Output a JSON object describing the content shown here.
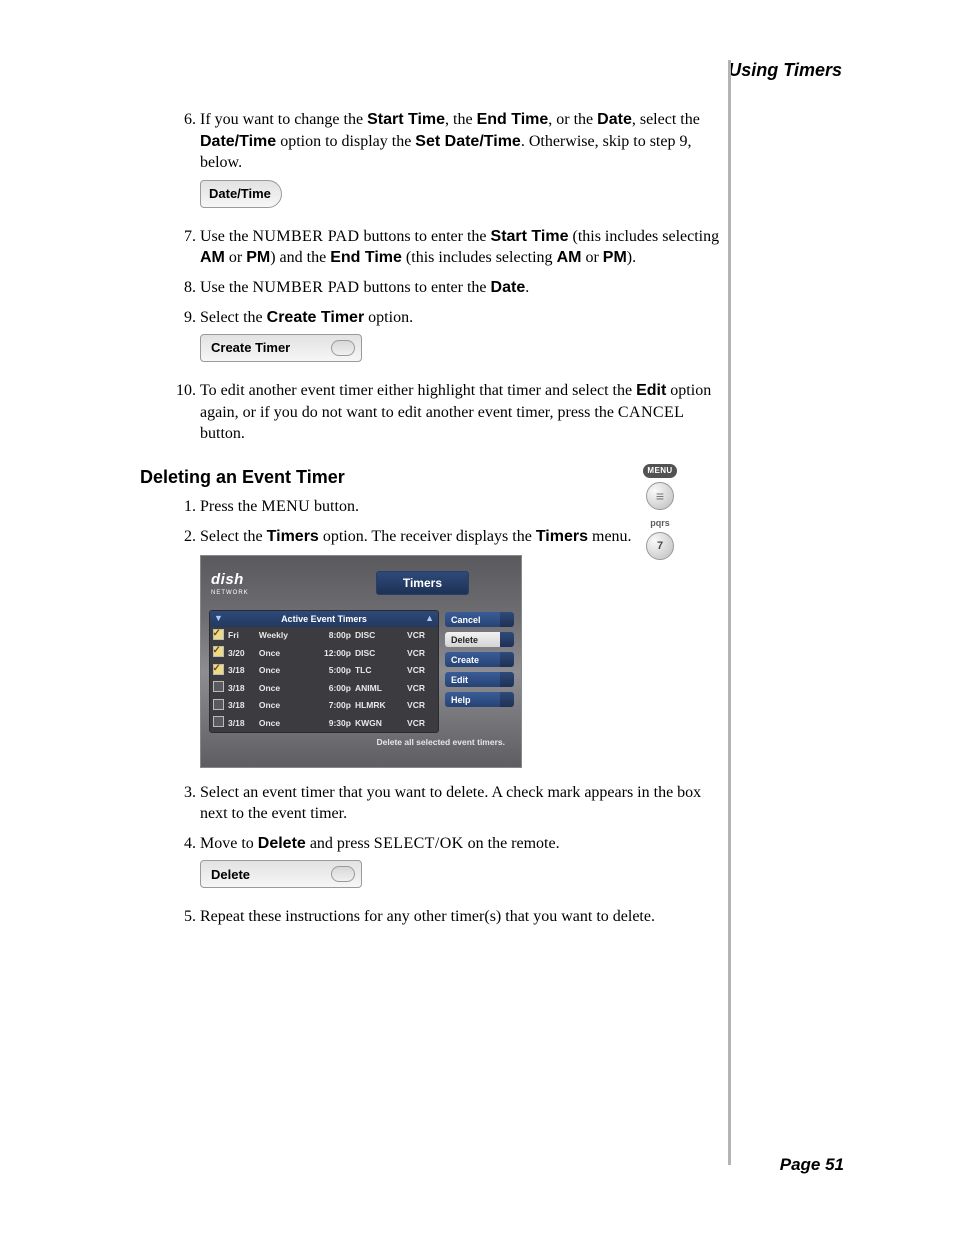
{
  "header": {
    "title": "Using Timers"
  },
  "footer": {
    "page_label": "Page 51"
  },
  "steps_a_start": 6,
  "steps_a": [
    {
      "pre": "If you want to change the ",
      "b1": "Start Time",
      "mid1": ", the ",
      "b2": "End Time",
      "mid2": ", or the ",
      "b3": "Date",
      "mid3": ", select the ",
      "b4": "Date/Time",
      "mid4": " option to display the ",
      "b5": "Set Date/Time",
      "post": ". Otherwise, skip to step 9, below."
    },
    {
      "pre": "Use the ",
      "sc1": "NUMBER PAD",
      "mid1": " buttons to enter the ",
      "b1": "Start Time",
      "mid2": " (this includes selecting ",
      "b2": "AM",
      "mid3": " or ",
      "b3": "PM",
      "mid4": ") and the ",
      "b4": "End Time",
      "mid5": " (this includes selecting ",
      "b5": "AM",
      "mid6": " or ",
      "b6": "PM",
      "post": ")."
    },
    {
      "pre": "Use the ",
      "sc1": "NUMBER PAD",
      "mid1": " buttons to enter the ",
      "b1": "Date",
      "post": "."
    },
    {
      "pre": "Select the ",
      "b1": "Create Timer",
      "post": " option."
    },
    {
      "pre": "To edit another event timer either highlight that timer and select the ",
      "b1": "Edit",
      "mid1": " option again, or if you do not want to edit another event timer, press the ",
      "sc1": "CANCEL",
      "post": " button."
    }
  ],
  "chips": {
    "datetime": "Date/Time",
    "create_timer": "Create Timer",
    "delete": "Delete"
  },
  "section_b_title": "Deleting an Event Timer",
  "steps_b": [
    {
      "pre": "Press the ",
      "sc1": "MENU",
      "post": " button."
    },
    {
      "pre": "Select the ",
      "b1": "Timers",
      "mid1": " option. The receiver displays the ",
      "b2": "Timers",
      "post": " menu."
    },
    {
      "pre": "Select an event timer that you want to delete. A check mark appears in the box next to the event timer.",
      "b1": "",
      "post": ""
    },
    {
      "pre": "Move to ",
      "b1": "Delete",
      "mid1": " and press ",
      "sc1": "SELECT/OK",
      "post": " on the remote."
    },
    {
      "pre": "Repeat these instructions for any other timer(s) that you want to delete.",
      "b1": "",
      "post": ""
    }
  ],
  "remote": {
    "menu_label": "MENU",
    "pqrs_label": "pqrs",
    "seven": "7"
  },
  "tv": {
    "logo": "dish",
    "logo_sub": "NETWORK",
    "title": "Timers",
    "list_header": "Active Event Timers",
    "hint": "Delete all selected event timers.",
    "buttons": [
      "Cancel",
      "Delete",
      "Create",
      "Edit",
      "Help"
    ],
    "button_styles": [
      "blue",
      "light",
      "blue",
      "blue",
      "blue"
    ],
    "rows": [
      {
        "ck": true,
        "c1": "Fri",
        "c2": "Weekly",
        "c3": "8:00p",
        "c4": "DISC",
        "c5": "VCR"
      },
      {
        "ck": true,
        "c1": "3/20",
        "c2": "Once",
        "c3": "12:00p",
        "c4": "DISC",
        "c5": "VCR"
      },
      {
        "ck": true,
        "c1": "3/18",
        "c2": "Once",
        "c3": "5:00p",
        "c4": "TLC",
        "c5": "VCR"
      },
      {
        "ck": false,
        "c1": "3/18",
        "c2": "Once",
        "c3": "6:00p",
        "c4": "ANIML",
        "c5": "VCR"
      },
      {
        "ck": false,
        "c1": "3/18",
        "c2": "Once",
        "c3": "7:00p",
        "c4": "HLMRK",
        "c5": "VCR"
      },
      {
        "ck": false,
        "c1": "3/18",
        "c2": "Once",
        "c3": "9:30p",
        "c4": "KWGN",
        "c5": "VCR"
      }
    ]
  }
}
